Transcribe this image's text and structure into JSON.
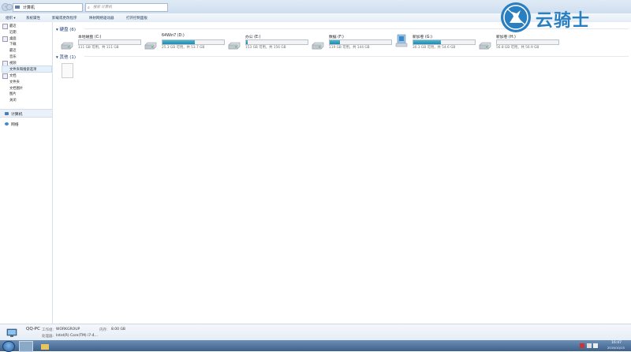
{
  "window": {
    "address": "计算机",
    "search_placeholder": "搜索 计算机"
  },
  "toolbar": {
    "items": [
      "组织 ▾",
      "系统属性",
      "卸载或更改程序",
      "映射网络驱动器",
      "打开控制面板"
    ]
  },
  "sidebar": {
    "items": [
      {
        "label": "最近"
      },
      {
        "label": "近期"
      },
      {
        "label": "桌面"
      },
      {
        "label": "下载"
      },
      {
        "label": "最近"
      },
      {
        "label": "音乐"
      },
      {
        "label": "视频"
      },
      {
        "label": "文档"
      },
      {
        "label": "文档"
      },
      {
        "label": "文件夹"
      },
      {
        "label": "文档图片"
      },
      {
        "label": "视频"
      },
      {
        "label": "图片"
      },
      {
        "label": "关闭"
      }
    ],
    "highlighted": "文件夹和搜索选项",
    "computer": "计算机",
    "network": "网络"
  },
  "main": {
    "hard_disks_header": "硬盘 (6)",
    "other_header": "其他 (1)",
    "drives": [
      {
        "name": "本地磁盘 (C:)",
        "free_text": "111 GB 可用，共 111 GB",
        "used_fraction": 0.0,
        "icon": "hard-drive-icon"
      },
      {
        "name": "64Win7 (D:)",
        "free_text": "25.3 GB 可用，共 53.7 GB",
        "used_fraction": 0.53,
        "icon": "hard-drive-icon"
      },
      {
        "name": "办公 (E:)",
        "free_text": "153 GB 可用，共 156 GB",
        "used_fraction": 0.02,
        "icon": "hard-drive-icon"
      },
      {
        "name": "数据 (F:)",
        "free_text": "119 GB 可用，共 144 GB",
        "used_fraction": 0.17,
        "icon": "hard-drive-icon"
      },
      {
        "name": "新加卷 (G:)",
        "free_text": "30.3 GB 可用，共 54.6 GB",
        "used_fraction": 0.45,
        "icon": "windows-drive-icon"
      },
      {
        "name": "新加卷 (H:)",
        "free_text": "56.8 GB 可用，共 56.9 GB",
        "used_fraction": 0.0,
        "icon": "hard-drive-icon"
      }
    ]
  },
  "details": {
    "pc_name": "QQ-PC",
    "workgroup_label": "工作组:",
    "workgroup": "WORKGROUP",
    "memory_label": "内存:",
    "memory": "8.00 GB",
    "processor_label": "处理器:",
    "processor": "Intel(R) Core(TM) i7-4..."
  },
  "taskbar": {
    "time": "16:47",
    "date": "2019/10/15"
  },
  "watermark": {
    "text": "云骑士"
  },
  "colors": {
    "accent": "#2a7fc0",
    "bar_fill": "#1f8aab",
    "header_text": "#1e3e74"
  }
}
